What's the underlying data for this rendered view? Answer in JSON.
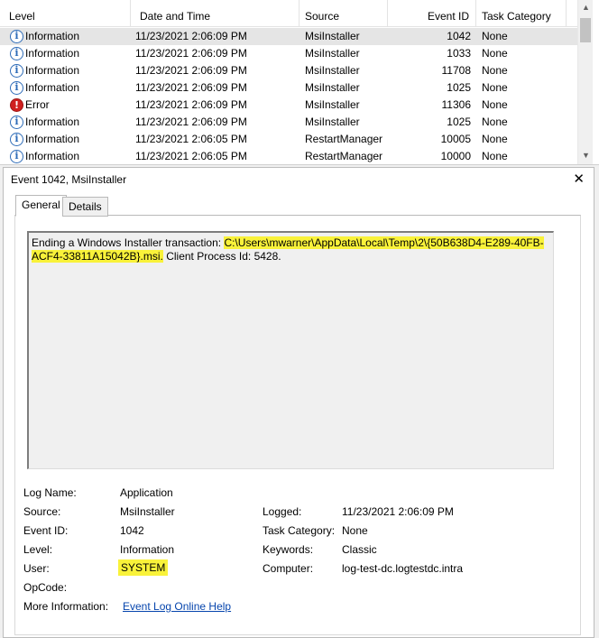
{
  "list": {
    "columns": {
      "level": "Level",
      "datetime": "Date and Time",
      "source": "Source",
      "event_id": "Event ID",
      "task_category": "Task Category"
    },
    "rows": [
      {
        "level": "Information",
        "icon": "info-icon",
        "datetime": "11/23/2021 2:06:09 PM",
        "source": "MsiInstaller",
        "event_id": "1042",
        "task_category": "None",
        "selected": true
      },
      {
        "level": "Information",
        "icon": "info-icon",
        "datetime": "11/23/2021 2:06:09 PM",
        "source": "MsiInstaller",
        "event_id": "1033",
        "task_category": "None"
      },
      {
        "level": "Information",
        "icon": "info-icon",
        "datetime": "11/23/2021 2:06:09 PM",
        "source": "MsiInstaller",
        "event_id": "11708",
        "task_category": "None"
      },
      {
        "level": "Information",
        "icon": "info-icon",
        "datetime": "11/23/2021 2:06:09 PM",
        "source": "MsiInstaller",
        "event_id": "1025",
        "task_category": "None"
      },
      {
        "level": "Error",
        "icon": "error-icon",
        "datetime": "11/23/2021 2:06:09 PM",
        "source": "MsiInstaller",
        "event_id": "11306",
        "task_category": "None"
      },
      {
        "level": "Information",
        "icon": "info-icon",
        "datetime": "11/23/2021 2:06:09 PM",
        "source": "MsiInstaller",
        "event_id": "1025",
        "task_category": "None"
      },
      {
        "level": "Information",
        "icon": "info-icon",
        "datetime": "11/23/2021 2:06:05 PM",
        "source": "RestartManager",
        "event_id": "10005",
        "task_category": "None"
      },
      {
        "level": "Information",
        "icon": "info-icon",
        "datetime": "11/23/2021 2:06:05 PM",
        "source": "RestartManager",
        "event_id": "10000",
        "task_category": "None"
      }
    ]
  },
  "detail": {
    "title": "Event 1042, MsiInstaller",
    "close": "✕",
    "tabs": {
      "general": "General",
      "details": "Details"
    },
    "message": {
      "prefix": "Ending a Windows Installer transaction: ",
      "path_line1": "C:\\Users\\mwarner\\AppData\\Local\\Temp\\2\\{50B638D4-E289-40FB-",
      "path_line2": "ACF4-33811A15042B}.msi.",
      "suffix": " Client Process Id: 5428."
    },
    "fields": {
      "log_name_label": "Log Name:",
      "log_name": "Application",
      "source_label": "Source:",
      "source": "MsiInstaller",
      "logged_label": "Logged:",
      "logged": "11/23/2021 2:06:09 PM",
      "event_id_label": "Event ID:",
      "event_id": "1042",
      "task_category_label": "Task Category:",
      "task_category": "None",
      "level_label": "Level:",
      "level": "Information",
      "keywords_label": "Keywords:",
      "keywords": "Classic",
      "user_label": "User:",
      "user": "SYSTEM",
      "computer_label": "Computer:",
      "computer": "log-test-dc.logtestdc.intra",
      "opcode_label": "OpCode:",
      "opcode": "",
      "more_info_label": "More Information:",
      "more_info_link": "Event Log Online Help"
    }
  },
  "colors": {
    "highlight": "#f9f23a",
    "link": "#0645ad",
    "selected_row": "#e5e5e5"
  }
}
